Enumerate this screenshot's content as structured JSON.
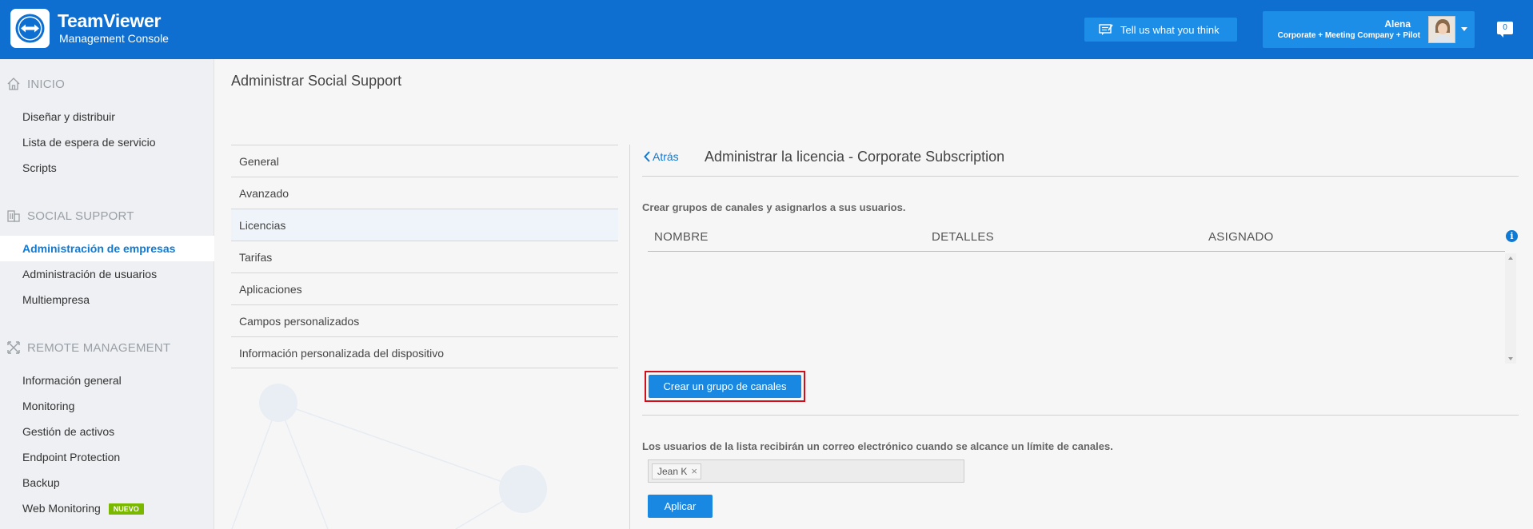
{
  "header": {
    "brand_bold": "Team",
    "brand_thin": "Viewer",
    "brand_sub": "Management Console",
    "feedback_label": "Tell us what you think",
    "user_name": "Alena",
    "user_plan": "Corporate + Meeting Company + Pilot",
    "notification_count": "0",
    "accent_color": "#0e6fd1"
  },
  "sidebar": {
    "sections": [
      {
        "label": "INICIO",
        "icon": "home-icon",
        "items": [
          "Diseñar y distribuir",
          "Lista de espera de servicio",
          "Scripts"
        ]
      },
      {
        "label": "SOCIAL SUPPORT",
        "icon": "building-icon",
        "items": [
          "Administración de empresas",
          "Administración de usuarios",
          "Multiempresa"
        ]
      },
      {
        "label": "REMOTE MANAGEMENT",
        "icon": "arrows-icon",
        "items": [
          "Información general",
          "Monitoring",
          "Gestión de activos",
          "Endpoint Protection",
          "Backup",
          "Web Monitoring"
        ]
      }
    ],
    "active_item": "Administración de empresas",
    "new_badge": "NUEVO"
  },
  "main": {
    "page_title": "Administrar Social Support",
    "menu": [
      "General",
      "Avanzado",
      "Licencias",
      "Tarifas",
      "Aplicaciones",
      "Campos personalizados",
      "Información personalizada del dispositivo"
    ],
    "selected_menu": "Licencias"
  },
  "license_panel": {
    "back_label": "Atrás",
    "title": "Administrar la licencia - Corporate Subscription",
    "description": "Crear grupos de canales y asignarlos a sus usuarios.",
    "columns": [
      "NOMBRE",
      "DETALLES",
      "ASIGNADO"
    ],
    "create_button": "Crear un grupo de canales",
    "notify_description": "Los usuarios de la lista recibirán un correo electrónico cuando se alcance un límite de canales.",
    "tag_user": "Jean K",
    "apply_button": "Aplicar"
  }
}
